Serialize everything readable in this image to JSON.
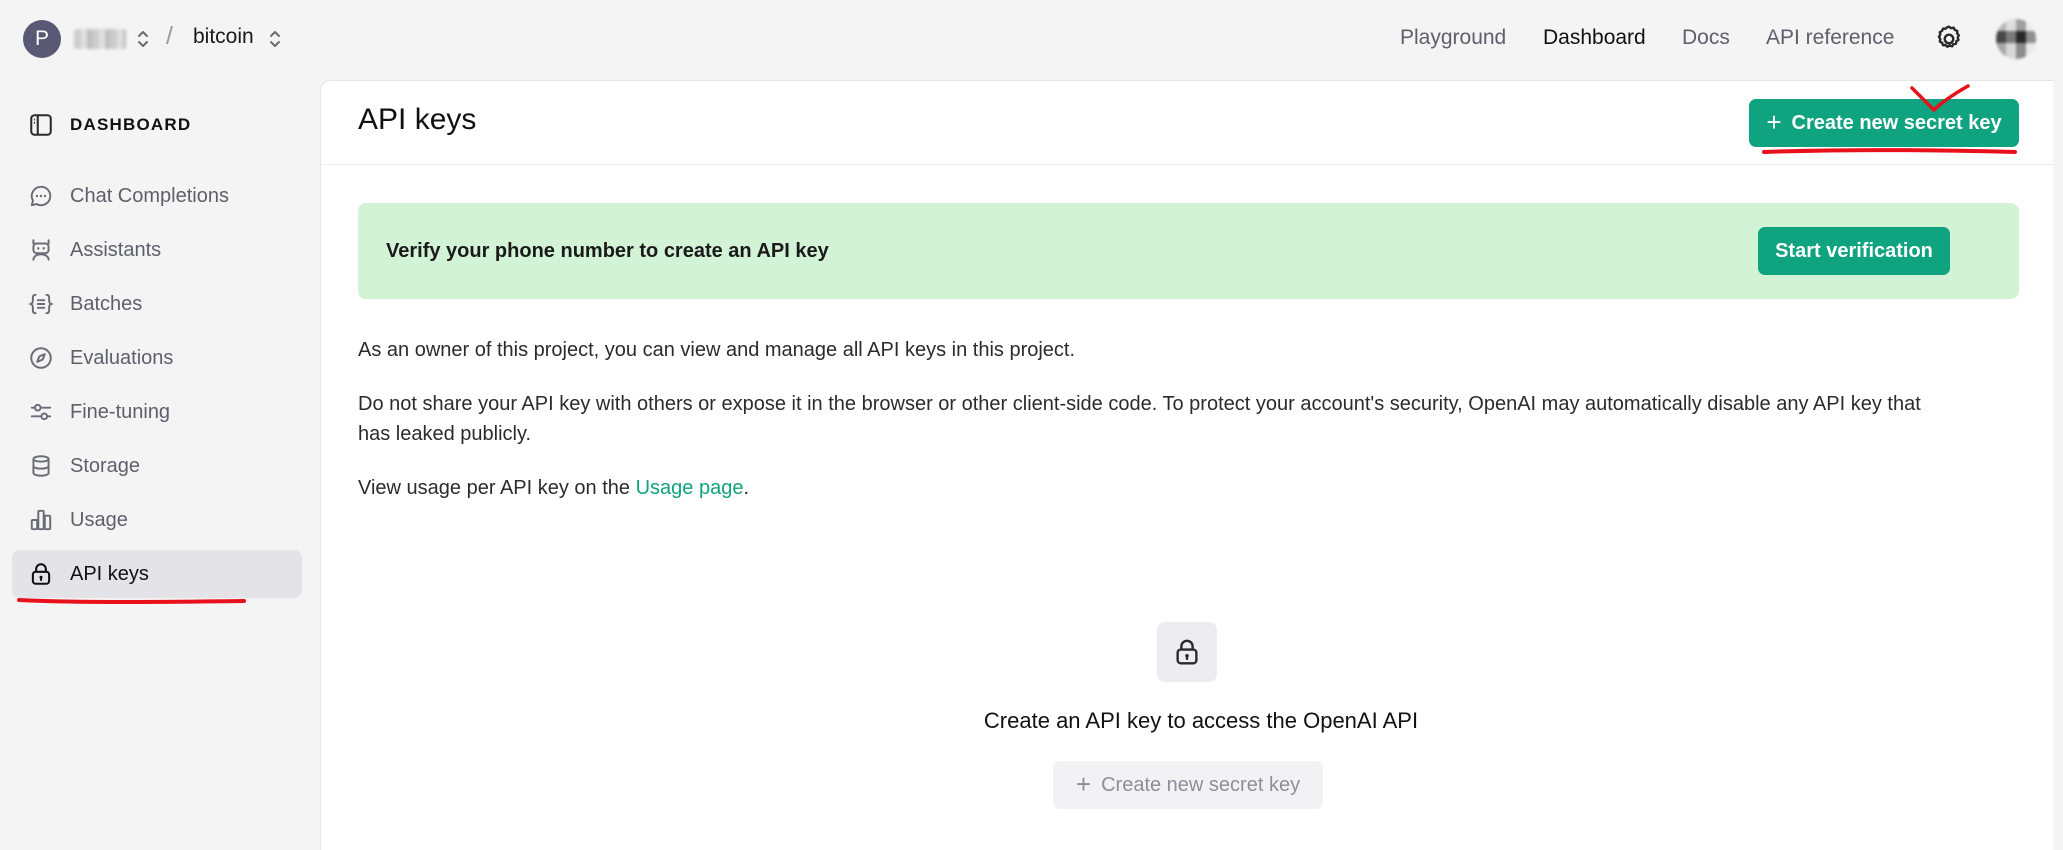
{
  "topbar": {
    "org_initial": "P",
    "separator": "/",
    "project": "bitcoin",
    "nav": [
      {
        "label": "Playground",
        "active": false
      },
      {
        "label": "Dashboard",
        "active": true
      },
      {
        "label": "Docs",
        "active": false
      },
      {
        "label": "API reference",
        "active": false
      }
    ],
    "settings_icon": "gear-icon"
  },
  "sidebar": {
    "header": "DASHBOARD",
    "items": [
      {
        "label": "Chat Completions",
        "icon": "chat-bubble-icon",
        "active": false
      },
      {
        "label": "Assistants",
        "icon": "robot-icon",
        "active": false
      },
      {
        "label": "Batches",
        "icon": "braces-list-icon",
        "active": false
      },
      {
        "label": "Evaluations",
        "icon": "compass-icon",
        "active": false
      },
      {
        "label": "Fine-tuning",
        "icon": "sliders-icon",
        "active": false
      },
      {
        "label": "Storage",
        "icon": "database-icon",
        "active": false
      },
      {
        "label": "Usage",
        "icon": "bar-chart-icon",
        "active": false
      },
      {
        "label": "API keys",
        "icon": "lock-icon",
        "active": true
      }
    ]
  },
  "main": {
    "title": "API keys",
    "create_button": "Create new secret key",
    "banner": {
      "text": "Verify your phone number to create an API key",
      "button": "Start verification"
    },
    "paragraph1": "As an owner of this project, you can view and manage all API keys in this project.",
    "paragraph2_line1": "Do not share your API key with others or expose it in the browser or other client-side code. To protect your account's security, OpenAI may automatically disable any API key that",
    "paragraph2_line2": "has leaked publicly.",
    "paragraph3_prefix": "View usage per API key on the ",
    "paragraph3_link": "Usage page",
    "paragraph3_suffix": ".",
    "empty_state": {
      "title": "Create an API key to access the OpenAI API",
      "button": "Create new secret key"
    }
  },
  "colors": {
    "accent": "#10a37f",
    "banner_bg": "#d3f3d6",
    "annotation": "#e8101a"
  }
}
